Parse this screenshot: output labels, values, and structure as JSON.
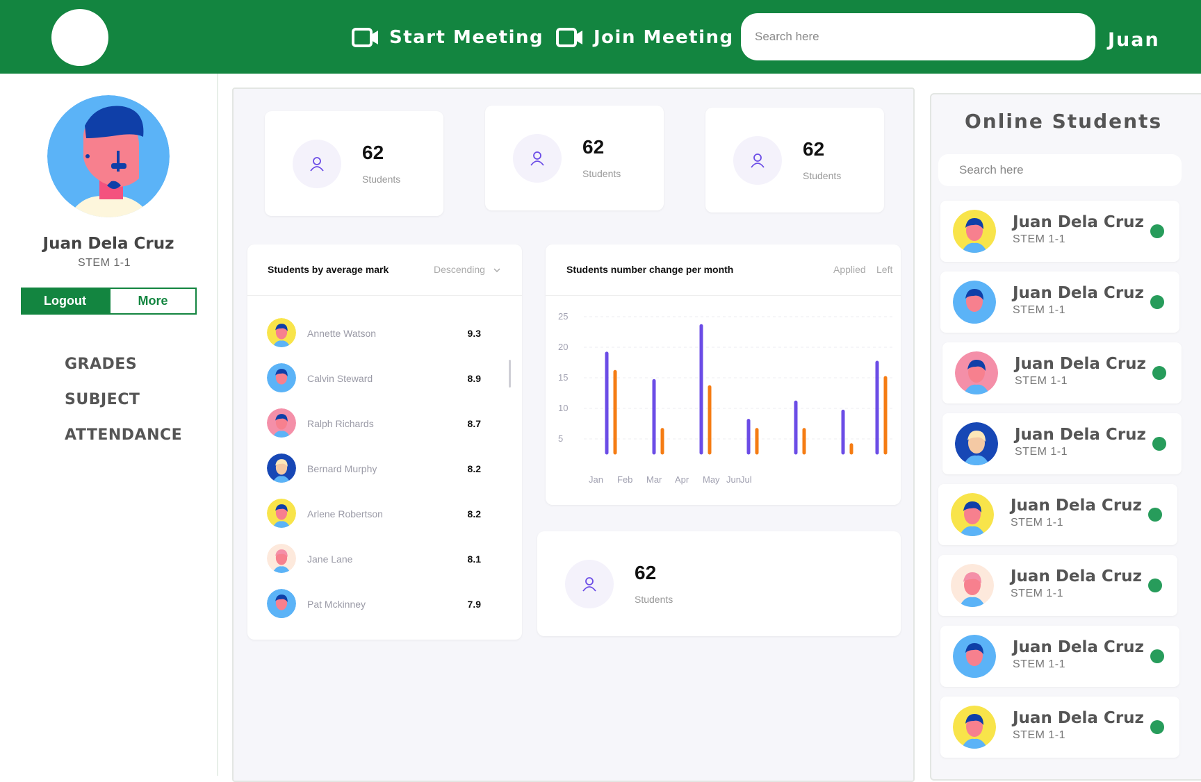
{
  "header": {
    "start_meeting": "Start Meeting",
    "join_meeting": "Join Meeting",
    "search_placeholder": "Search here",
    "user": "Juan",
    "brand_color": "#138540"
  },
  "profile": {
    "name": "Juan Dela Cruz",
    "class": "STEM 1-1",
    "logout": "Logout",
    "more": "More"
  },
  "nav": [
    "GRADES",
    "SUBJECT",
    "ATTENDANCE"
  ],
  "stats": [
    {
      "value": "62",
      "label": "Students"
    },
    {
      "value": "62",
      "label": "Students"
    },
    {
      "value": "62",
      "label": "Students"
    },
    {
      "value": "62",
      "label": "Students"
    }
  ],
  "marks": {
    "title": "Students by average mark",
    "sort": "Descending",
    "rows": [
      {
        "name": "Annette Watson",
        "score": "9.3"
      },
      {
        "name": "Calvin Steward",
        "score": "8.9"
      },
      {
        "name": "Ralph Richards",
        "score": "8.7"
      },
      {
        "name": "Bernard Murphy",
        "score": "8.2"
      },
      {
        "name": "Arlene Robertson",
        "score": "8.2"
      },
      {
        "name": "Jane Lane",
        "score": "8.1"
      },
      {
        "name": "Pat Mckinney",
        "score": "7.9"
      }
    ]
  },
  "chart_card": {
    "title": "Students number change per month",
    "filter_applied": "Applied",
    "filter_left": "Left"
  },
  "chart_data": {
    "type": "bar",
    "categories": [
      "Jan",
      "Feb",
      "Mar",
      "Apr",
      "May",
      "Jun",
      "Jul"
    ],
    "series": [
      {
        "name": "Applied",
        "color": "#6b4ce6",
        "values": [
          19,
          14.5,
          23.5,
          8,
          11,
          9.5,
          17.5
        ]
      },
      {
        "name": "Left",
        "color": "#f57c13",
        "values": [
          16,
          6.5,
          13.5,
          6.5,
          6.5,
          4,
          15
        ]
      }
    ],
    "yticks": [
      5,
      10,
      15,
      20,
      25
    ],
    "ylim": [
      0,
      25
    ],
    "grid": true
  },
  "online": {
    "title": "Online Students",
    "search_placeholder": "Search here",
    "students": [
      {
        "name": "Juan Dela Cruz",
        "class": "STEM 1-1",
        "avatar": "yellow"
      },
      {
        "name": "Juan Dela Cruz",
        "class": "STEM 1-1",
        "avatar": "blue"
      },
      {
        "name": "Juan Dela Cruz",
        "class": "STEM 1-1",
        "avatar": "pink"
      },
      {
        "name": "Juan Dela Cruz",
        "class": "STEM 1-1",
        "avatar": "navy"
      },
      {
        "name": "Juan Dela Cruz",
        "class": "STEM 1-1",
        "avatar": "yellow"
      },
      {
        "name": "Juan Dela Cruz",
        "class": "STEM 1-1",
        "avatar": "cream"
      },
      {
        "name": "Juan Dela Cruz",
        "class": "STEM 1-1",
        "avatar": "blue"
      },
      {
        "name": "Juan Dela Cruz",
        "class": "STEM 1-1",
        "avatar": "yellow"
      }
    ]
  }
}
